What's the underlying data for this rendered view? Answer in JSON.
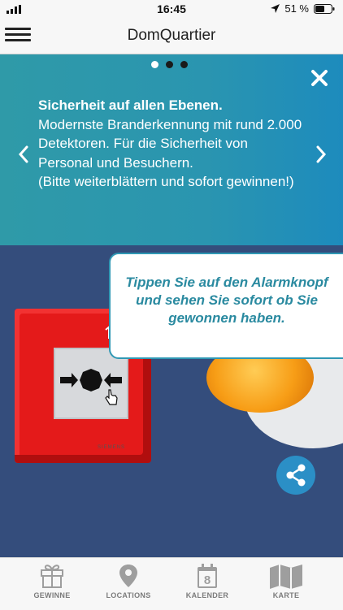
{
  "status_bar": {
    "time": "16:45",
    "battery": "51 %"
  },
  "nav": {
    "title": "DomQuartier"
  },
  "banner": {
    "title": "Sicherheit auf allen Ebenen.",
    "text": "Modernste Branderkennung mit rund 2.000 Detektoren. Für die Sicherheit von Personal und Besuchern.",
    "hint": "(Bitte weiterblättern und sofort gewinnen!)",
    "slide_count": 3,
    "active_slide": 1
  },
  "scene": {
    "brand_label": "SIEMENS",
    "bubble_text": "Tippen Sie auf den Alarmknopf und sehen Sie sofort ob Sie gewonnen haben.",
    "button_color": "#e41a1a",
    "siren_color": "#f79d16",
    "share_color": "#2b8fc6"
  },
  "tabbar": {
    "items": [
      {
        "label": "GEWINNE",
        "icon": "gift-icon"
      },
      {
        "label": "LOCATIONS",
        "icon": "location-pin-icon"
      },
      {
        "label": "KALENDER",
        "icon": "calendar-icon",
        "badge": "8"
      },
      {
        "label": "KARTE",
        "icon": "map-icon"
      }
    ]
  }
}
